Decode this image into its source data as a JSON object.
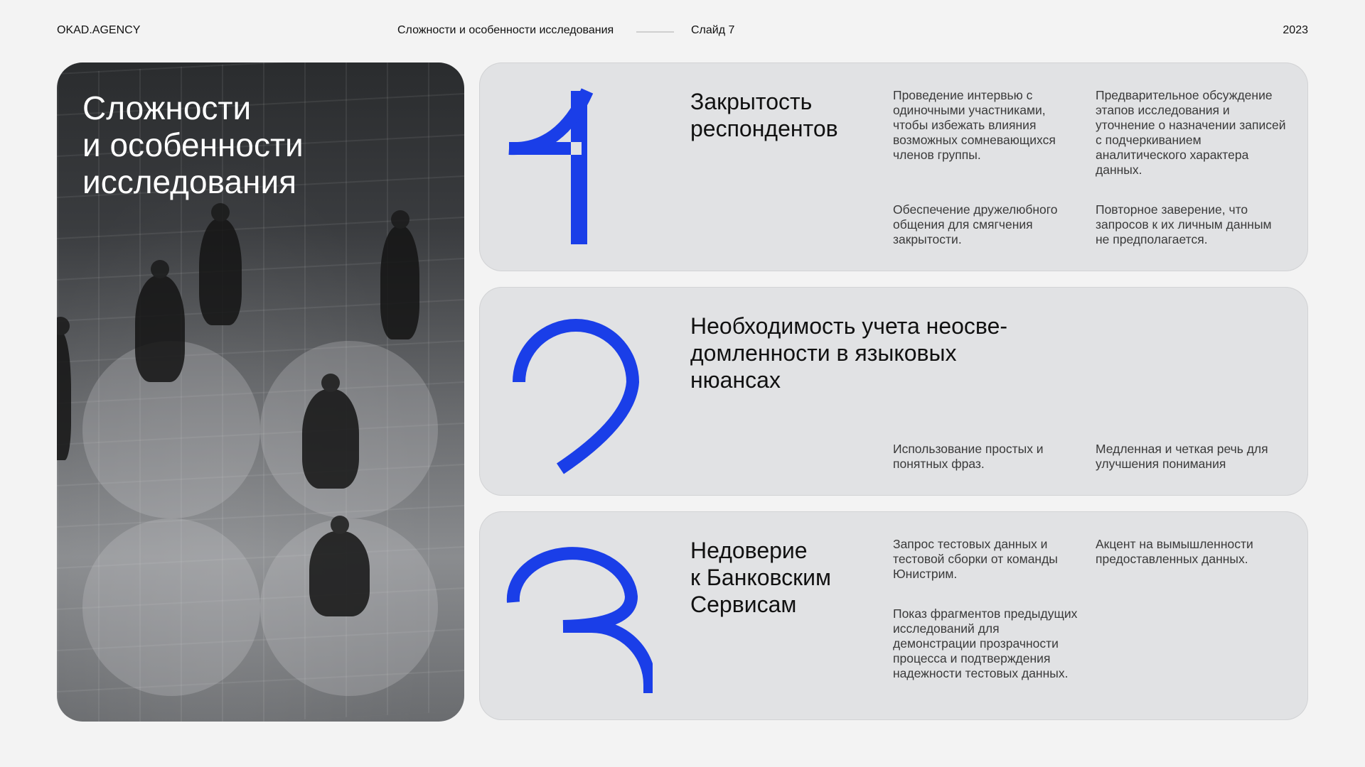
{
  "header": {
    "brand": "OKAD.AGENCY",
    "breadcrumb": "Сложности и особенности исследования",
    "slide": "Слайд 7",
    "year": "2023"
  },
  "photo": {
    "title_lines": [
      "Сложности",
      "и особенности",
      "исследования"
    ]
  },
  "accent_color": "#1a3ee8",
  "cards": [
    {
      "number": "1",
      "title_lines": [
        "Закрытость",
        "респондентов"
      ],
      "notes": [
        "Проведение интервью с одиночными участниками, чтобы избежать влияния возможных сомневающихся членов группы.",
        "Предварительное обсуждение этапов исследования и уточнение о назначении записей с подчеркиванием аналитического характера данных.",
        "Обеспечение дружелюбного общения для смягчения закрытости.",
        "Повторное заверение, что запросов к их личным данным не предполагается."
      ]
    },
    {
      "number": "2",
      "title_lines": [
        "Необходимость учета неосве-",
        "домленности в языковых",
        "нюансах"
      ],
      "notes": [
        "Использование простых и понятных фраз.",
        "Медленная и четкая речь для улучшения понимания"
      ]
    },
    {
      "number": "3",
      "title_lines": [
        "Недоверие",
        "к Банковским",
        "Сервисам"
      ],
      "notes": [
        "Запрос тестовых данных и тестовой сборки от команды Юнистрим.",
        "Акцент на вымышленности предоставленных данных.",
        "Показ фрагментов предыдущих исследований для демонстрации прозрачности процесса и подтверждения надежности тестовых данных."
      ]
    }
  ]
}
